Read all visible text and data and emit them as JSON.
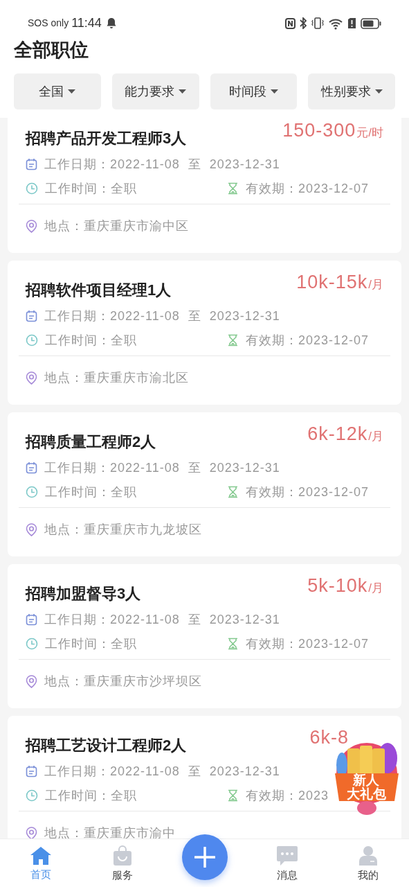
{
  "status_bar": {
    "carrier": "SOS only",
    "time": "11:44"
  },
  "title": "全部职位",
  "filters": [
    {
      "label": "全国"
    },
    {
      "label": "能力要求"
    },
    {
      "label": "时间段"
    },
    {
      "label": "性别要求"
    }
  ],
  "jobs": [
    {
      "title": "招聘产品开发工程师3人",
      "salary": "150-300",
      "unit": "元/时",
      "dates": "工作日期：2022-11-08  至  2023-12-31",
      "hours": "工作时间：全职",
      "valid": "有效期：2023-12-07",
      "location": "地点：重庆重庆市渝中区"
    },
    {
      "title": "招聘软件项目经理1人",
      "salary": "10k-15k",
      "unit": "/月",
      "dates": "工作日期：2022-11-08  至  2023-12-31",
      "hours": "工作时间：全职",
      "valid": "有效期：2023-12-07",
      "location": "地点：重庆重庆市渝北区"
    },
    {
      "title": "招聘质量工程师2人",
      "salary": "6k-12k",
      "unit": "/月",
      "dates": "工作日期：2022-11-08  至  2023-12-31",
      "hours": "工作时间：全职",
      "valid": "有效期：2023-12-07",
      "location": "地点：重庆重庆市九龙坡区"
    },
    {
      "title": "招聘加盟督导3人",
      "salary": "5k-10k",
      "unit": "/月",
      "dates": "工作日期：2022-11-08  至  2023-12-31",
      "hours": "工作时间：全职",
      "valid": "有效期：2023-12-07",
      "location": "地点：重庆重庆市沙坪坝区"
    },
    {
      "title": "招聘工艺设计工程师2人",
      "salary": "6k-8",
      "dates": "工作日期：2022-11-08  至  2023-12-31",
      "hours": "工作时间：全职",
      "valid": "有效期：2023",
      "location": "地点：重庆重庆市渝中"
    }
  ],
  "gift_badge": {
    "line1": "新人",
    "line2": "大礼包"
  },
  "nav": [
    {
      "kind": "home",
      "label": "首页",
      "selected": true
    },
    {
      "kind": "service",
      "label": "服务",
      "selected": false
    },
    {
      "kind": "add"
    },
    {
      "kind": "message",
      "label": "消息",
      "selected": false
    },
    {
      "kind": "me",
      "label": "我的",
      "selected": false
    }
  ]
}
